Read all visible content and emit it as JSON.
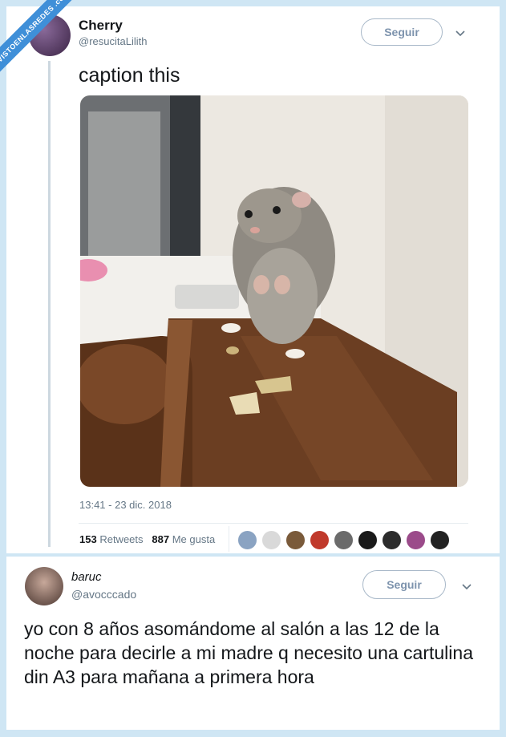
{
  "watermark": {
    "text": "VISTOENLASREDES .com"
  },
  "tweet1": {
    "name": "Cherry",
    "handle": "@resucitaLilith",
    "follow_label": "Seguir",
    "text": "caption this",
    "timestamp": "13:41 - 23 dic. 2018",
    "retweets_count": "153",
    "retweets_label": "Retweets",
    "likes_count": "887",
    "likes_label": "Me gusta",
    "liker_avatars": [
      "#8aa3c2",
      "#d9d9d9",
      "#7a5a3a",
      "#c0392b",
      "#6b6b6b",
      "#1a1a1a",
      "#2c2c2c",
      "#9b4b8a",
      "#222222"
    ]
  },
  "tweet2": {
    "name": "baruc",
    "handle": "@avocccado",
    "follow_label": "Seguir",
    "text": "yo con 8 años asomándome al salón a las 12 de la noche para decirle a mi madre q necesito una cartulina din A3 para mañana a primera hora"
  },
  "icons": {
    "dropdown": "chevron-down-icon"
  }
}
